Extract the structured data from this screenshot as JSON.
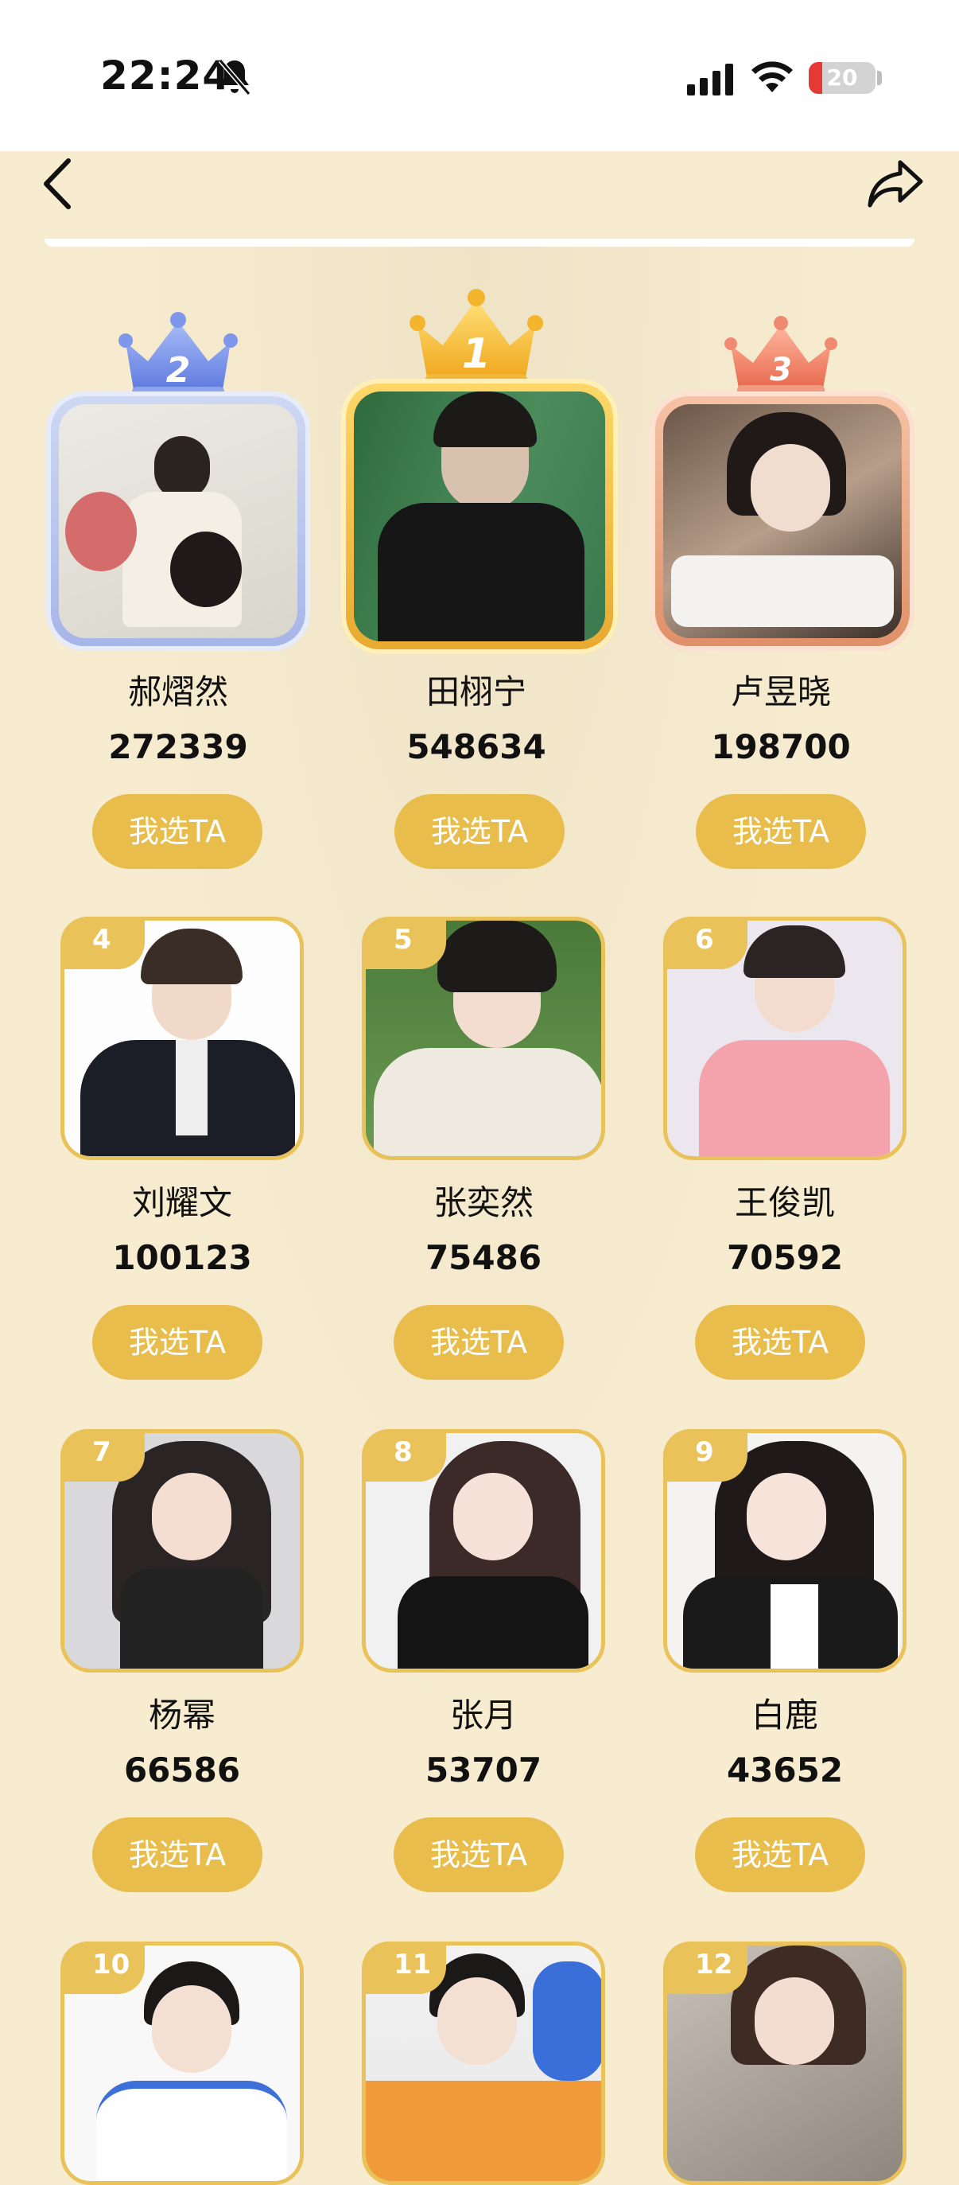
{
  "status_bar": {
    "time": "22:24",
    "battery_level": "20",
    "icons": [
      "bell-off-icon",
      "signal-icon",
      "wifi-icon",
      "battery-icon"
    ]
  },
  "nav": {
    "icons": [
      "back-icon",
      "share-icon"
    ]
  },
  "colors": {
    "accent": "#e9bd4c",
    "background": "#f7ecd0",
    "battery_low": "#e53935"
  },
  "top3": [
    {
      "rank": "2",
      "name": "郝熠然",
      "votes": "272339",
      "vote_label": "我选TA",
      "frame": "silver"
    },
    {
      "rank": "1",
      "name": "田栩宁",
      "votes": "548634",
      "vote_label": "我选TA",
      "frame": "gold"
    },
    {
      "rank": "3",
      "name": "卢昱晓",
      "votes": "198700",
      "vote_label": "我选TA",
      "frame": "bronze"
    }
  ],
  "rankings": [
    {
      "rank": "4",
      "name": "刘耀文",
      "votes": "100123",
      "vote_label": "我选TA"
    },
    {
      "rank": "5",
      "name": "张奕然",
      "votes": "75486",
      "vote_label": "我选TA"
    },
    {
      "rank": "6",
      "name": "王俊凯",
      "votes": "70592",
      "vote_label": "我选TA"
    },
    {
      "rank": "7",
      "name": "杨幂",
      "votes": "66586",
      "vote_label": "我选TA"
    },
    {
      "rank": "8",
      "name": "张月",
      "votes": "53707",
      "vote_label": "我选TA"
    },
    {
      "rank": "9",
      "name": "白鹿",
      "votes": "43652",
      "vote_label": "我选TA"
    },
    {
      "rank": "10"
    },
    {
      "rank": "11"
    },
    {
      "rank": "12"
    }
  ]
}
